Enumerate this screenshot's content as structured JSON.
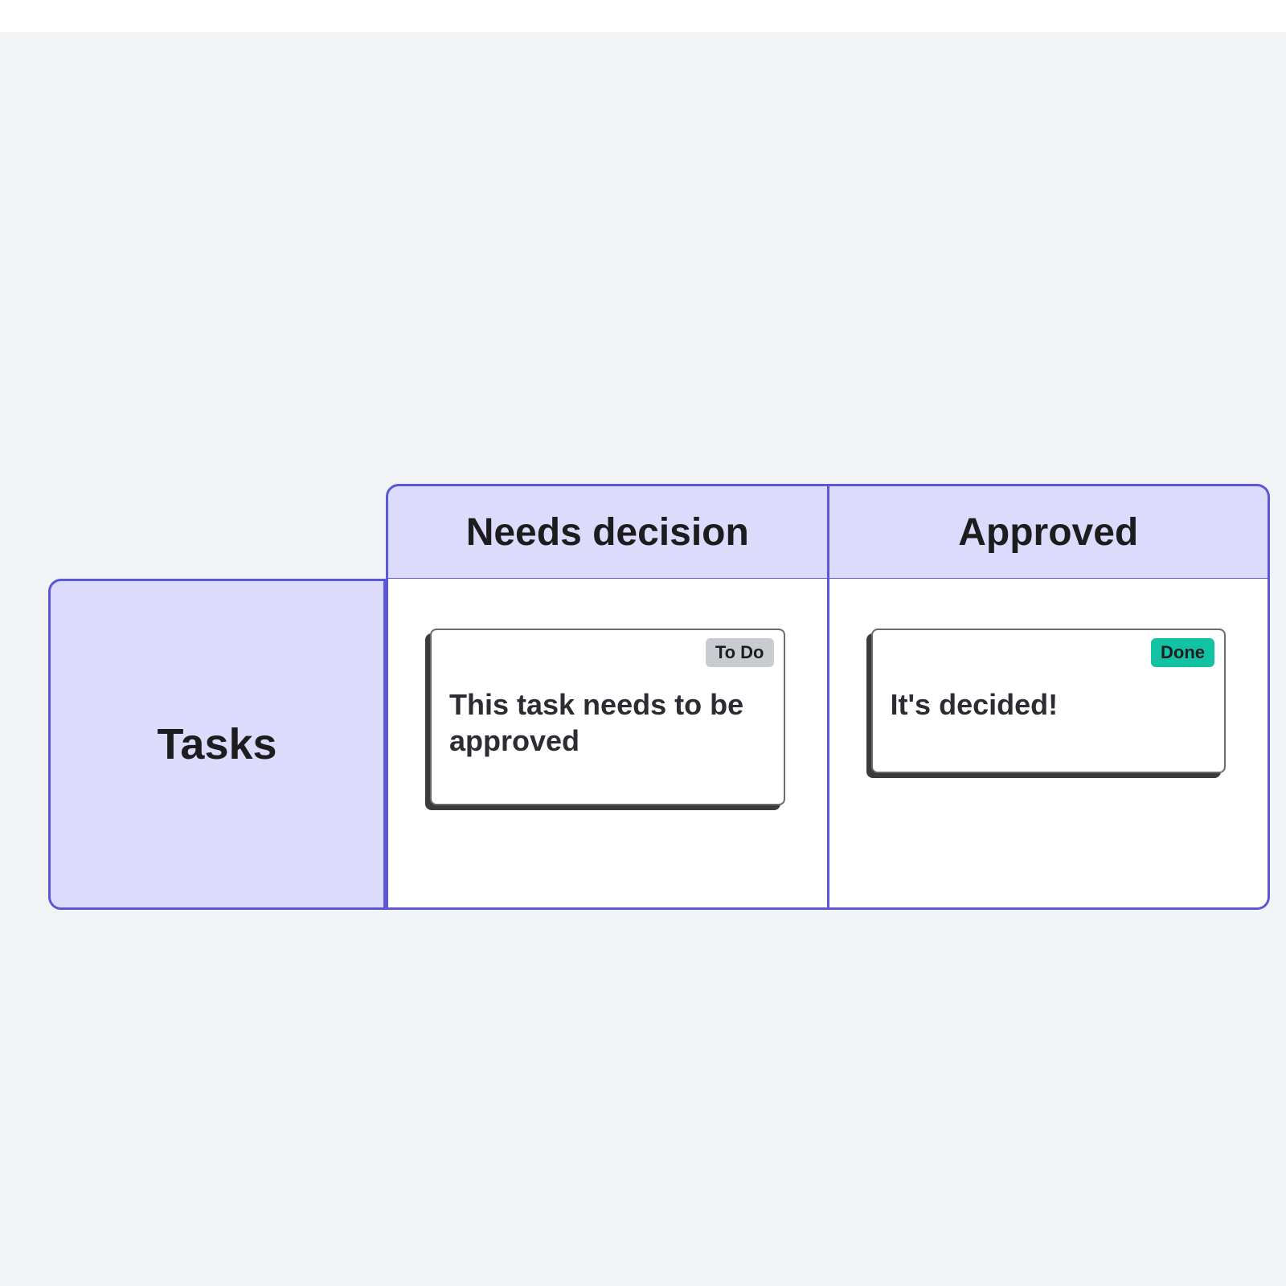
{
  "board": {
    "row_label": "Tasks",
    "columns": [
      {
        "label": "Needs decision"
      },
      {
        "label": "Approved"
      }
    ],
    "cards": {
      "needs_decision": {
        "status_label": "To Do",
        "title": "This task needs to be approved"
      },
      "approved": {
        "status_label": "Done",
        "title": "It's decided!"
      }
    }
  }
}
